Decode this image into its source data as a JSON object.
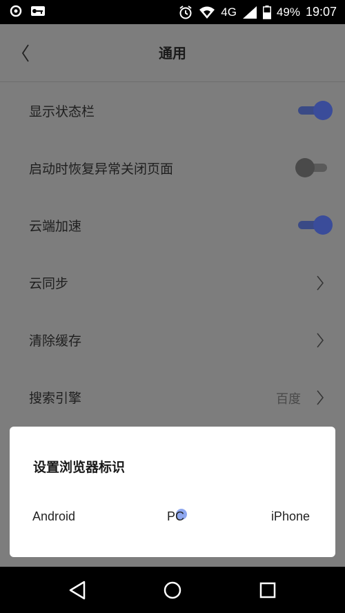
{
  "status_bar": {
    "network": "4G",
    "battery": "49%",
    "time": "19:07",
    "icons": [
      "record-icon",
      "key-icon",
      "alarm-icon",
      "wifi-icon",
      "signal-icon",
      "battery-icon"
    ]
  },
  "header": {
    "title": "通用",
    "back_icon": "chevron-left-icon"
  },
  "settings": [
    {
      "label": "显示状态栏",
      "control": "toggle",
      "on": true
    },
    {
      "label": "启动时恢复异常关闭页面",
      "control": "toggle",
      "on": false
    },
    {
      "label": "云端加速",
      "control": "toggle",
      "on": true
    },
    {
      "label": "云同步",
      "control": "chevron"
    },
    {
      "label": "清除缓存",
      "control": "chevron"
    },
    {
      "label": "搜索引擎",
      "control": "chevron",
      "value": "百度"
    }
  ],
  "dialog": {
    "title": "设置浏览器标识",
    "options": [
      "Android",
      "PC",
      "iPhone"
    ]
  },
  "colors": {
    "toggle_on": "#3a4c9a",
    "ripple": "#8ea7ef"
  }
}
